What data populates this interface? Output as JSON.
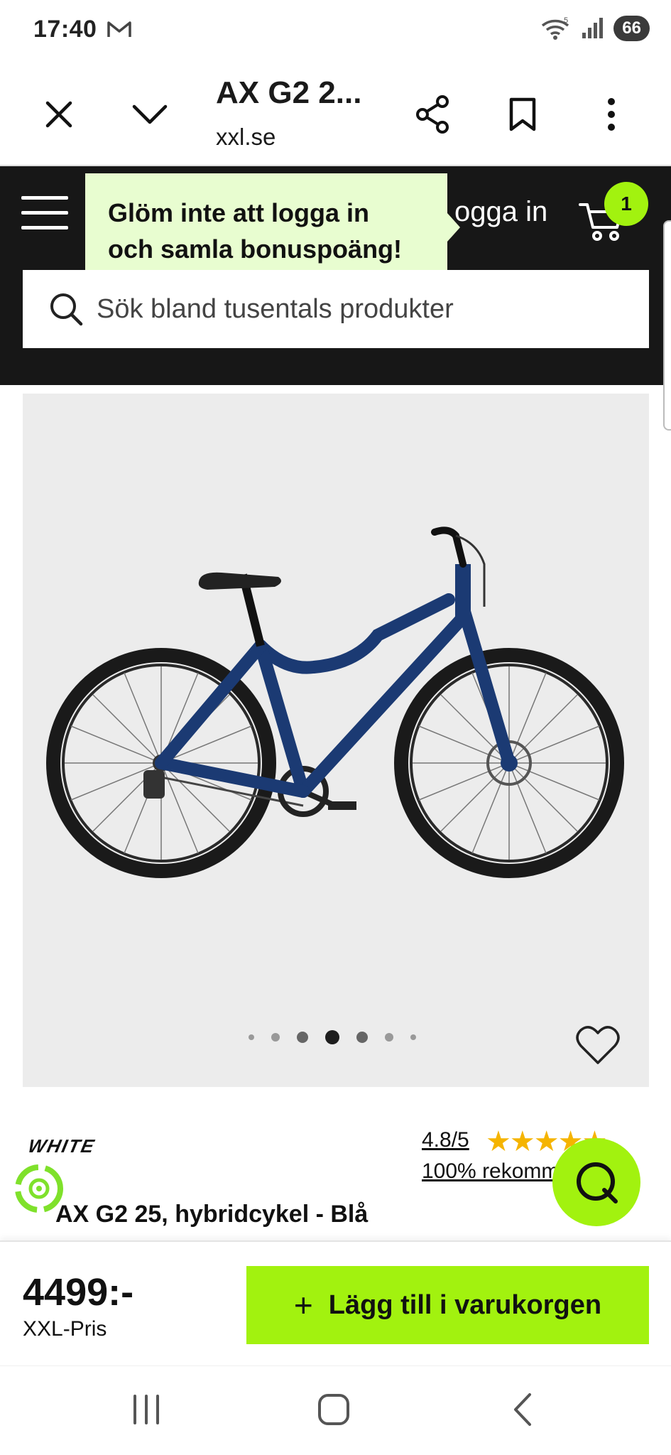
{
  "status_bar": {
    "time": "17:40",
    "battery": "66",
    "wifi_label": "5"
  },
  "browser": {
    "title": "AX G2 2...",
    "domain": "xxl.se"
  },
  "header": {
    "tooltip_line1": "Glöm inte att logga in",
    "tooltip_line2": "och samla bonuspoäng!",
    "login_label": "ogga in",
    "cart_count": "1",
    "search_placeholder": "Sök bland tusentals produkter"
  },
  "gallery": {
    "image_count": 7,
    "active_index": 3
  },
  "product": {
    "brand": "WHITE",
    "rating": "4.8/5",
    "stars": "★★★★★",
    "recommend": "100% rekommenderar",
    "name": "AX G2 25, hybridcykel - Blå"
  },
  "buy": {
    "price": "4499:-",
    "price_label": "XXL-Pris",
    "add_to_cart": "Lägg till i varukorgen",
    "add_icon": "+"
  },
  "colors": {
    "accent": "#a2f20f",
    "header_bg": "#171717",
    "tooltip_bg": "#e8fdd0",
    "frame_blue": "#1b3a73"
  }
}
